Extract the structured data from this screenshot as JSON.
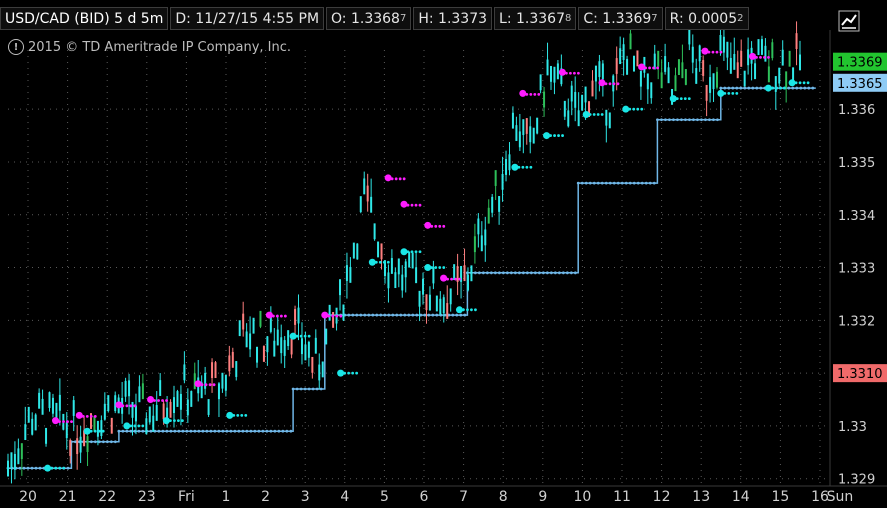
{
  "header": {
    "symbol": "USD/CAD (BID) 5 d 5m",
    "date": "D: 11/27/15 4:55 PM",
    "open": "O: 1.3368",
    "open_sub": "7",
    "high": "H: 1.3373",
    "low": "L: 1.3367",
    "low_sub": "8",
    "close": "C: 1.3369",
    "close_sub": "7",
    "range": "R: 0.0005",
    "range_sub": "2"
  },
  "copyright": "2015 © TD Ameritrade IP Company, Inc.",
  "icons": {
    "info": "info-icon",
    "style": "chart-style-icon"
  },
  "colors": {
    "background": "#000000",
    "grid": "#5a5a5a",
    "candle_up": "#2fe8e8",
    "candle_down": "#ff7f7f",
    "bar_mid": "#2ec05a",
    "resistance_dots": "#ff1cff",
    "support_dots": "#1ae6e6",
    "trail_line": "#6fb6e6",
    "last_price_badge": "#22c52f",
    "bid_badge": "#8ecbf5",
    "ref_badge": "#f06a6a"
  },
  "chart_data": {
    "type": "line",
    "title": "USD/CAD (BID) 5 d 5m",
    "ylim": [
      1.3289,
      1.3375
    ],
    "y_ticks": [
      "1.329",
      "1.33",
      "1.331",
      "1.332",
      "1.333",
      "1.334",
      "1.335",
      "1.336"
    ],
    "y_tick_values": [
      1.329,
      1.33,
      1.331,
      1.332,
      1.333,
      1.334,
      1.335,
      1.336
    ],
    "x_ticks": [
      "20",
      "21",
      "22",
      "23",
      "Fri",
      "1",
      "2",
      "3",
      "4",
      "5",
      "6",
      "7",
      "8",
      "9",
      "10",
      "11",
      "12",
      "13",
      "14",
      "15",
      "16",
      "Sun"
    ],
    "x_tick_positions": [
      0.0,
      0.05,
      0.1,
      0.15,
      0.2,
      0.25,
      0.3,
      0.35,
      0.4,
      0.45,
      0.5,
      0.55,
      0.6,
      0.65,
      0.7,
      0.75,
      0.8,
      0.85,
      0.9,
      0.95,
      1.0,
      1.05
    ],
    "price_labels": [
      {
        "text": "1.3369",
        "value": 1.3369,
        "color": "#22c52f"
      },
      {
        "text": "1.3365",
        "value": 1.3365,
        "color": "#8ecbf5"
      },
      {
        "text": "1.3310",
        "value": 1.331,
        "color": "#f06a6a"
      }
    ],
    "price_path": {
      "x": [
        0.0,
        0.03,
        0.06,
        0.09,
        0.12,
        0.15,
        0.18,
        0.21,
        0.24,
        0.27,
        0.3,
        0.33,
        0.36,
        0.39,
        0.42,
        0.45,
        0.48,
        0.5,
        0.52,
        0.55,
        0.58,
        0.6,
        0.62,
        0.64,
        0.66,
        0.68,
        0.7,
        0.72,
        0.74,
        0.76,
        0.78,
        0.8,
        0.82,
        0.84,
        0.86,
        0.88,
        0.9,
        0.92,
        0.94,
        0.96,
        0.98,
        1.0
      ],
      "y": [
        1.3292,
        1.3302,
        1.3301,
        1.3299,
        1.3303,
        1.3304,
        1.3302,
        1.3307,
        1.3306,
        1.3308,
        1.3318,
        1.3316,
        1.3319,
        1.3311,
        1.3323,
        1.3343,
        1.3331,
        1.3328,
        1.3327,
        1.3324,
        1.3328,
        1.3338,
        1.3345,
        1.3358,
        1.3352,
        1.3367,
        1.3363,
        1.3358,
        1.3366,
        1.3361,
        1.3372,
        1.3364,
        1.3368,
        1.3362,
        1.3371,
        1.3365,
        1.3371,
        1.3366,
        1.337,
        1.3368,
        1.3369,
        1.3369
      ]
    },
    "support_steps": {
      "x": [
        0.0,
        0.08,
        0.08,
        0.14,
        0.14,
        0.36,
        0.36,
        0.4,
        0.4,
        0.58,
        0.58,
        0.72,
        0.72,
        0.82,
        0.82,
        0.9,
        0.9,
        1.02
      ],
      "y": [
        1.3292,
        1.3292,
        1.3297,
        1.3297,
        1.3299,
        1.3299,
        1.3307,
        1.3307,
        1.3321,
        1.3321,
        1.3329,
        1.3329,
        1.3346,
        1.3346,
        1.3358,
        1.3358,
        1.3364,
        1.3364
      ]
    },
    "resistance_dots": {
      "x": [
        0.06,
        0.09,
        0.14,
        0.18,
        0.24,
        0.33,
        0.4,
        0.48,
        0.5,
        0.53,
        0.55,
        0.65,
        0.7,
        0.75,
        0.8,
        0.88,
        0.94
      ],
      "y": [
        1.3301,
        1.3302,
        1.3304,
        1.3305,
        1.3308,
        1.3321,
        1.3321,
        1.3347,
        1.3342,
        1.3338,
        1.3328,
        1.3363,
        1.3367,
        1.3365,
        1.3368,
        1.3371,
        1.337
      ]
    },
    "support_dots": {
      "x": [
        0.05,
        0.1,
        0.15,
        0.2,
        0.28,
        0.36,
        0.42,
        0.46,
        0.5,
        0.53,
        0.57,
        0.64,
        0.68,
        0.73,
        0.78,
        0.84,
        0.9,
        0.96,
        0.99
      ],
      "y": [
        1.3292,
        1.3299,
        1.33,
        1.3301,
        1.3302,
        1.3317,
        1.331,
        1.3331,
        1.3333,
        1.333,
        1.3322,
        1.3349,
        1.3355,
        1.3359,
        1.336,
        1.3362,
        1.3363,
        1.3364,
        1.3365
      ]
    }
  }
}
